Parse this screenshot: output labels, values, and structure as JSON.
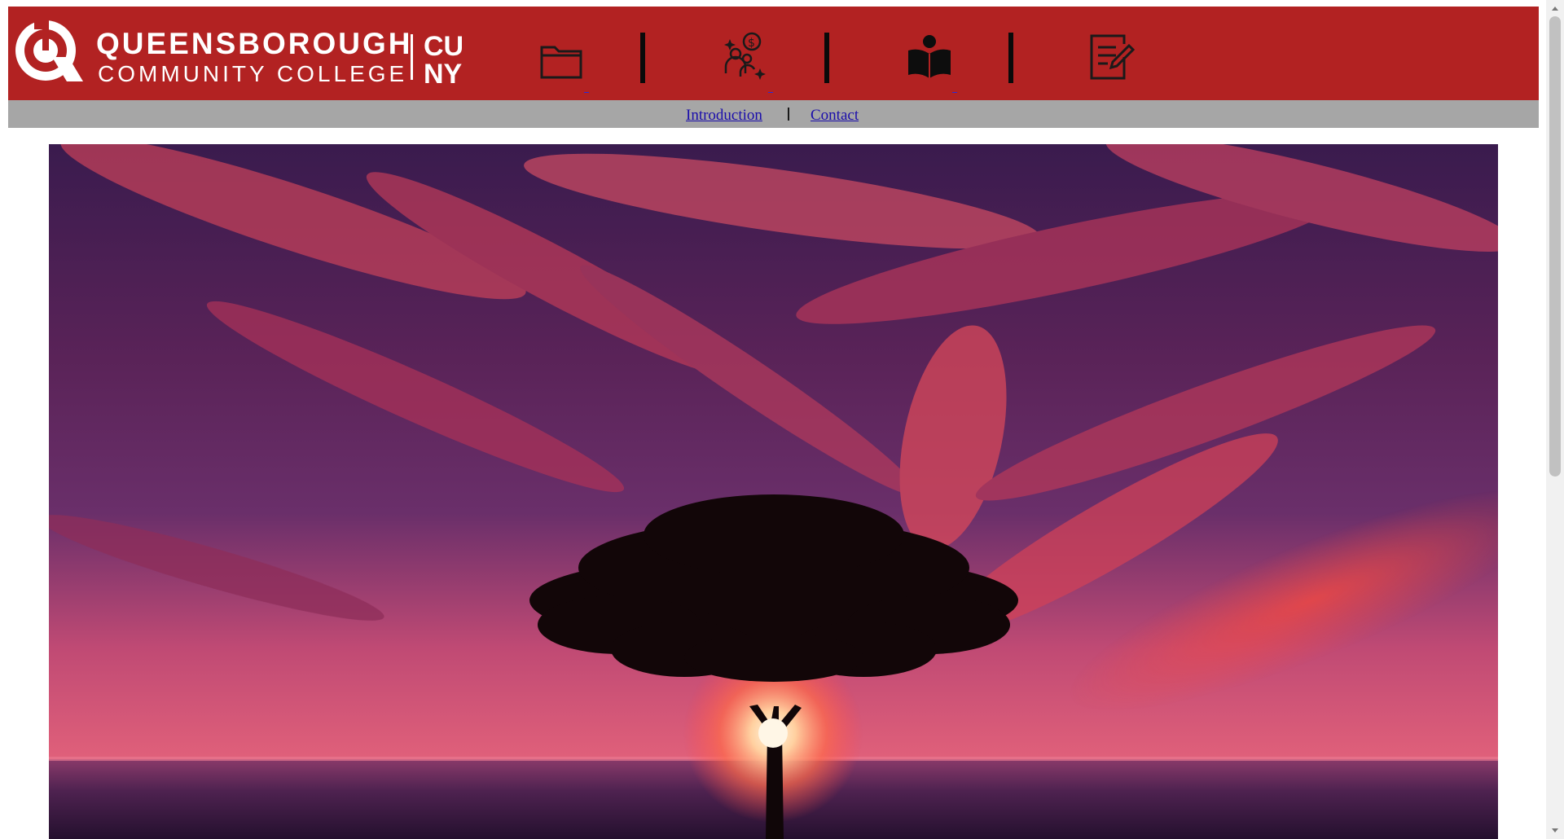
{
  "header": {
    "logo": {
      "line1": "QUEENSBOROUGH",
      "line2": "COMMUNITY COLLEGE",
      "cuny_top": "CU",
      "cuny_bottom": "NY"
    },
    "nav_icons": [
      {
        "icon": "folder-icon"
      },
      {
        "icon": "people-money-icon"
      },
      {
        "icon": "reader-book-icon"
      },
      {
        "icon": "edit-document-icon"
      }
    ],
    "colors": {
      "brand_red": "#b22222",
      "subnav_gray": "#a6a6a6"
    }
  },
  "subnav": {
    "links": [
      {
        "label": "Introduction"
      },
      {
        "label": "Contact"
      }
    ]
  },
  "hero": {
    "image": "sunset-tree-over-sea"
  }
}
